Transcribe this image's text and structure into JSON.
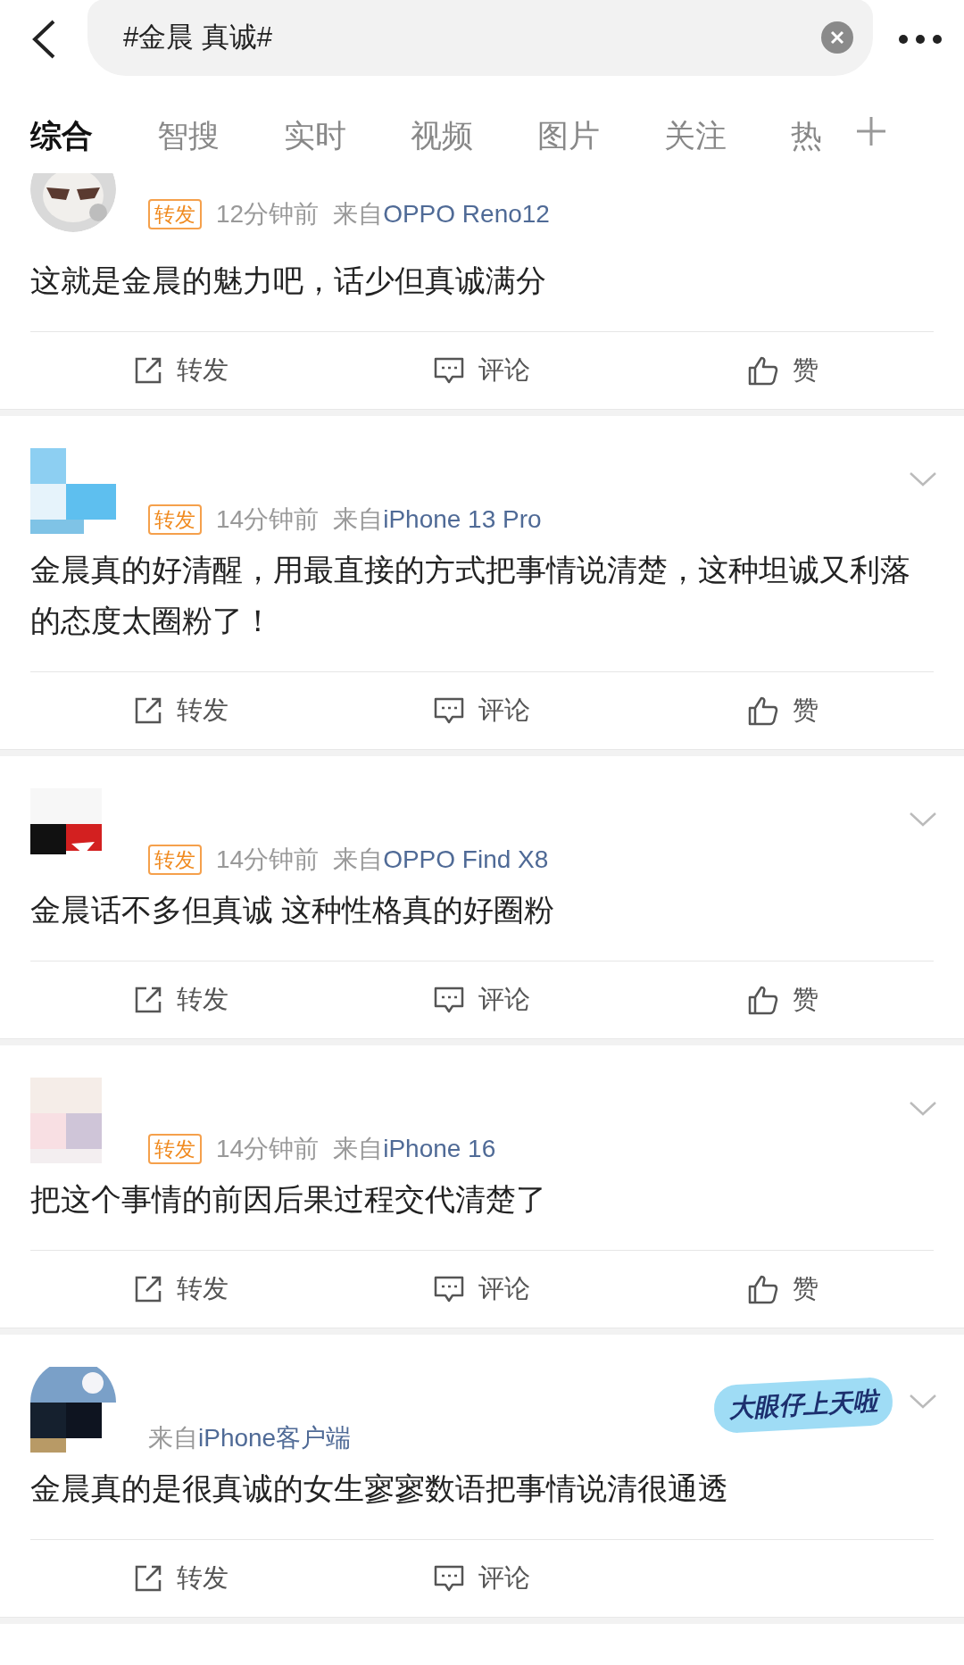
{
  "search": {
    "value": "#金晨 真诚#"
  },
  "tabs": [
    {
      "label": "综合",
      "selected": true
    },
    {
      "label": "智搜",
      "selected": false
    },
    {
      "label": "实时",
      "selected": false
    },
    {
      "label": "视频",
      "selected": false
    },
    {
      "label": "图片",
      "selected": false
    },
    {
      "label": "关注",
      "selected": false
    },
    {
      "label": "热",
      "selected": false
    }
  ],
  "posts": [
    {
      "menu": false,
      "tag": "转发",
      "time": "12分钟前",
      "via": "来自",
      "device": "OPPO Reno12",
      "text": "这就是金晨的魅力吧，话少但真诚满分",
      "actions": [
        "转发",
        "评论",
        "赞"
      ]
    },
    {
      "menu": true,
      "tag": "转发",
      "time": "14分钟前",
      "via": "来自",
      "device": "iPhone 13 Pro",
      "text": "金晨真的好清醒，用最直接的方式把事情说清楚，这种坦诚又利落的态度太圈粉了！",
      "actions": [
        "转发",
        "评论",
        "赞"
      ]
    },
    {
      "menu": true,
      "tag": "转发",
      "time": "14分钟前",
      "via": "来自",
      "device": "OPPO Find X8",
      "text": "金晨话不多但真诚 这种性格真的好圈粉",
      "actions": [
        "转发",
        "评论",
        "赞"
      ]
    },
    {
      "menu": true,
      "tag": "转发",
      "time": "14分钟前",
      "via": "来自",
      "device": "iPhone 16",
      "text": "把这个事情的前因后果过程交代清楚了",
      "actions": [
        "转发",
        "评论",
        "赞"
      ]
    },
    {
      "menu": true,
      "badge": "大眼仔上天啦",
      "via": "来自",
      "device": "iPhone客户端",
      "text": "金晨真的是很真诚的女生寥寥数语把事情说清很通透",
      "actions": [
        "转发",
        "评论"
      ]
    }
  ]
}
